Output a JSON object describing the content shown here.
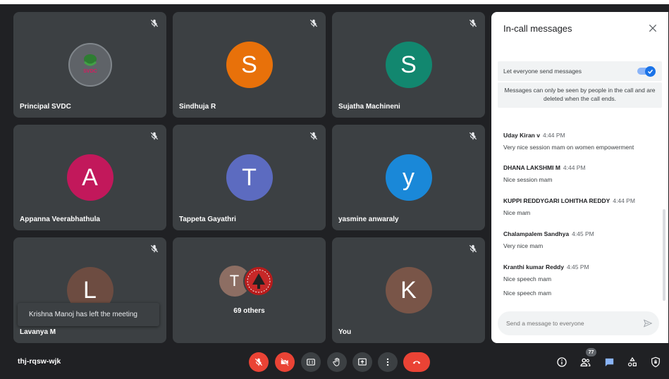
{
  "tiles": [
    {
      "name": "Principal SVDC",
      "initial": "",
      "color": "#5f6368",
      "logo_text": "SVDC",
      "muted": true
    },
    {
      "name": "Sindhuja R",
      "initial": "S",
      "color": "#e8710a",
      "muted": true
    },
    {
      "name": "Sujatha Machineni",
      "initial": "S",
      "color": "#12876f",
      "muted": true
    },
    {
      "name": "Appanna Veerabhathula",
      "initial": "A",
      "color": "#c2185b",
      "muted": true
    },
    {
      "name": "Tappeta Gayathri",
      "initial": "T",
      "color": "#5c6bc0",
      "muted": true
    },
    {
      "name": "yasmine anwaraly",
      "initial": "y",
      "color": "#1a88d8",
      "muted": true
    },
    {
      "name": "Lavanya M",
      "initial": "L",
      "color": "#6d4c41",
      "muted": true
    },
    {
      "name": "",
      "initial": "T",
      "color": "#8d6e63",
      "others_label": "69 others",
      "muted": false
    },
    {
      "name": "You",
      "initial": "K",
      "color": "#795548",
      "muted": true
    }
  ],
  "toast": "Krishna Manoj has left the meeting",
  "panel": {
    "title": "In-call messages",
    "toggle_label": "Let everyone send messages",
    "toggle_on": true,
    "notice": "Messages can only be seen by people in the call and are deleted when the call ends.",
    "messages": [
      {
        "sender": "Uday Kiran v",
        "time": "4:44 PM",
        "lines": [
          "Very nice session  mam on women empowerment"
        ]
      },
      {
        "sender": "DHANA LAKSHMI M",
        "time": "4:44 PM",
        "lines": [
          "Nice session mam"
        ]
      },
      {
        "sender": "KUPPI REDDYGARI LOHITHA REDDY",
        "time": "4:44 PM",
        "lines": [
          "Nice mam"
        ]
      },
      {
        "sender": "Chalampalem Sandhya",
        "time": "4:45 PM",
        "lines": [
          "Very nice mam"
        ]
      },
      {
        "sender": "Kranthi kumar Reddy",
        "time": "4:45 PM",
        "lines": [
          "Nice speech mam",
          "Nice speech mam"
        ]
      }
    ],
    "compose_placeholder": "Send a message to everyone"
  },
  "bottom": {
    "meeting_code": "thj-rqsw-wjk",
    "participant_count": "77"
  },
  "colors": {
    "background": "#202124",
    "tile": "#3c4043",
    "accent": "#1a73e8",
    "danger": "#ea4335"
  }
}
